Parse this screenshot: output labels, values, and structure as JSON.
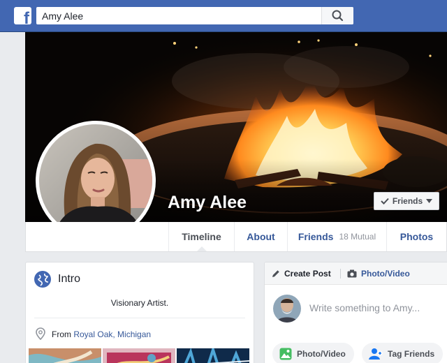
{
  "app": {
    "logo_letter": "f",
    "brand_color": "#4267b2",
    "link_color": "#365899"
  },
  "search": {
    "value": "Amy Alee",
    "icon": "search-icon"
  },
  "profile": {
    "name": "Amy Alee",
    "friends_button_label": "Friends"
  },
  "nav": {
    "tabs": [
      {
        "label": "Timeline",
        "active": true
      },
      {
        "label": "About"
      },
      {
        "label": "Friends",
        "badge": "18 Mutual"
      },
      {
        "label": "Photos"
      }
    ]
  },
  "intro": {
    "title": "Intro",
    "bio": "Visionary Artist.",
    "from_prefix": "From ",
    "from_location": "Royal Oak, Michigan"
  },
  "composer": {
    "create_post_label": "Create Post",
    "photo_video_tab_label": "Photo/Video",
    "placeholder": "Write something to Amy...",
    "actions": [
      {
        "label": "Photo/Video",
        "icon": "photo-icon"
      },
      {
        "label": "Tag Friends",
        "icon": "tag-friends-icon"
      }
    ]
  }
}
